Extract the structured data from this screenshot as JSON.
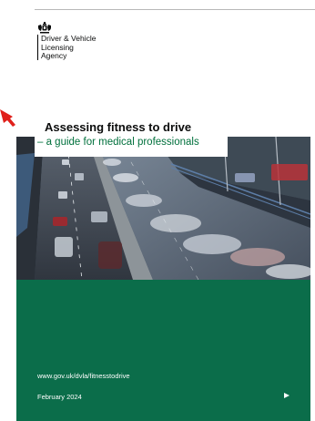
{
  "agency": {
    "lines": [
      "Driver & Vehicle",
      "Licensing",
      "Agency"
    ]
  },
  "cover": {
    "title": "Assessing fitness to drive",
    "subtitle": "– a guide for medical professionals"
  },
  "footer": {
    "url": "www.gov.uk/dvla/fitnesstodrive",
    "date": "February 2024"
  },
  "colors": {
    "green": "#0b6d4a",
    "subtitle_green": "#00703c",
    "arrow_red": "#e0201b"
  },
  "icons": {
    "crest": "royal-coat-of-arms-icon",
    "arrow": "red-arrow-icon",
    "play": "play-triangle-icon"
  }
}
